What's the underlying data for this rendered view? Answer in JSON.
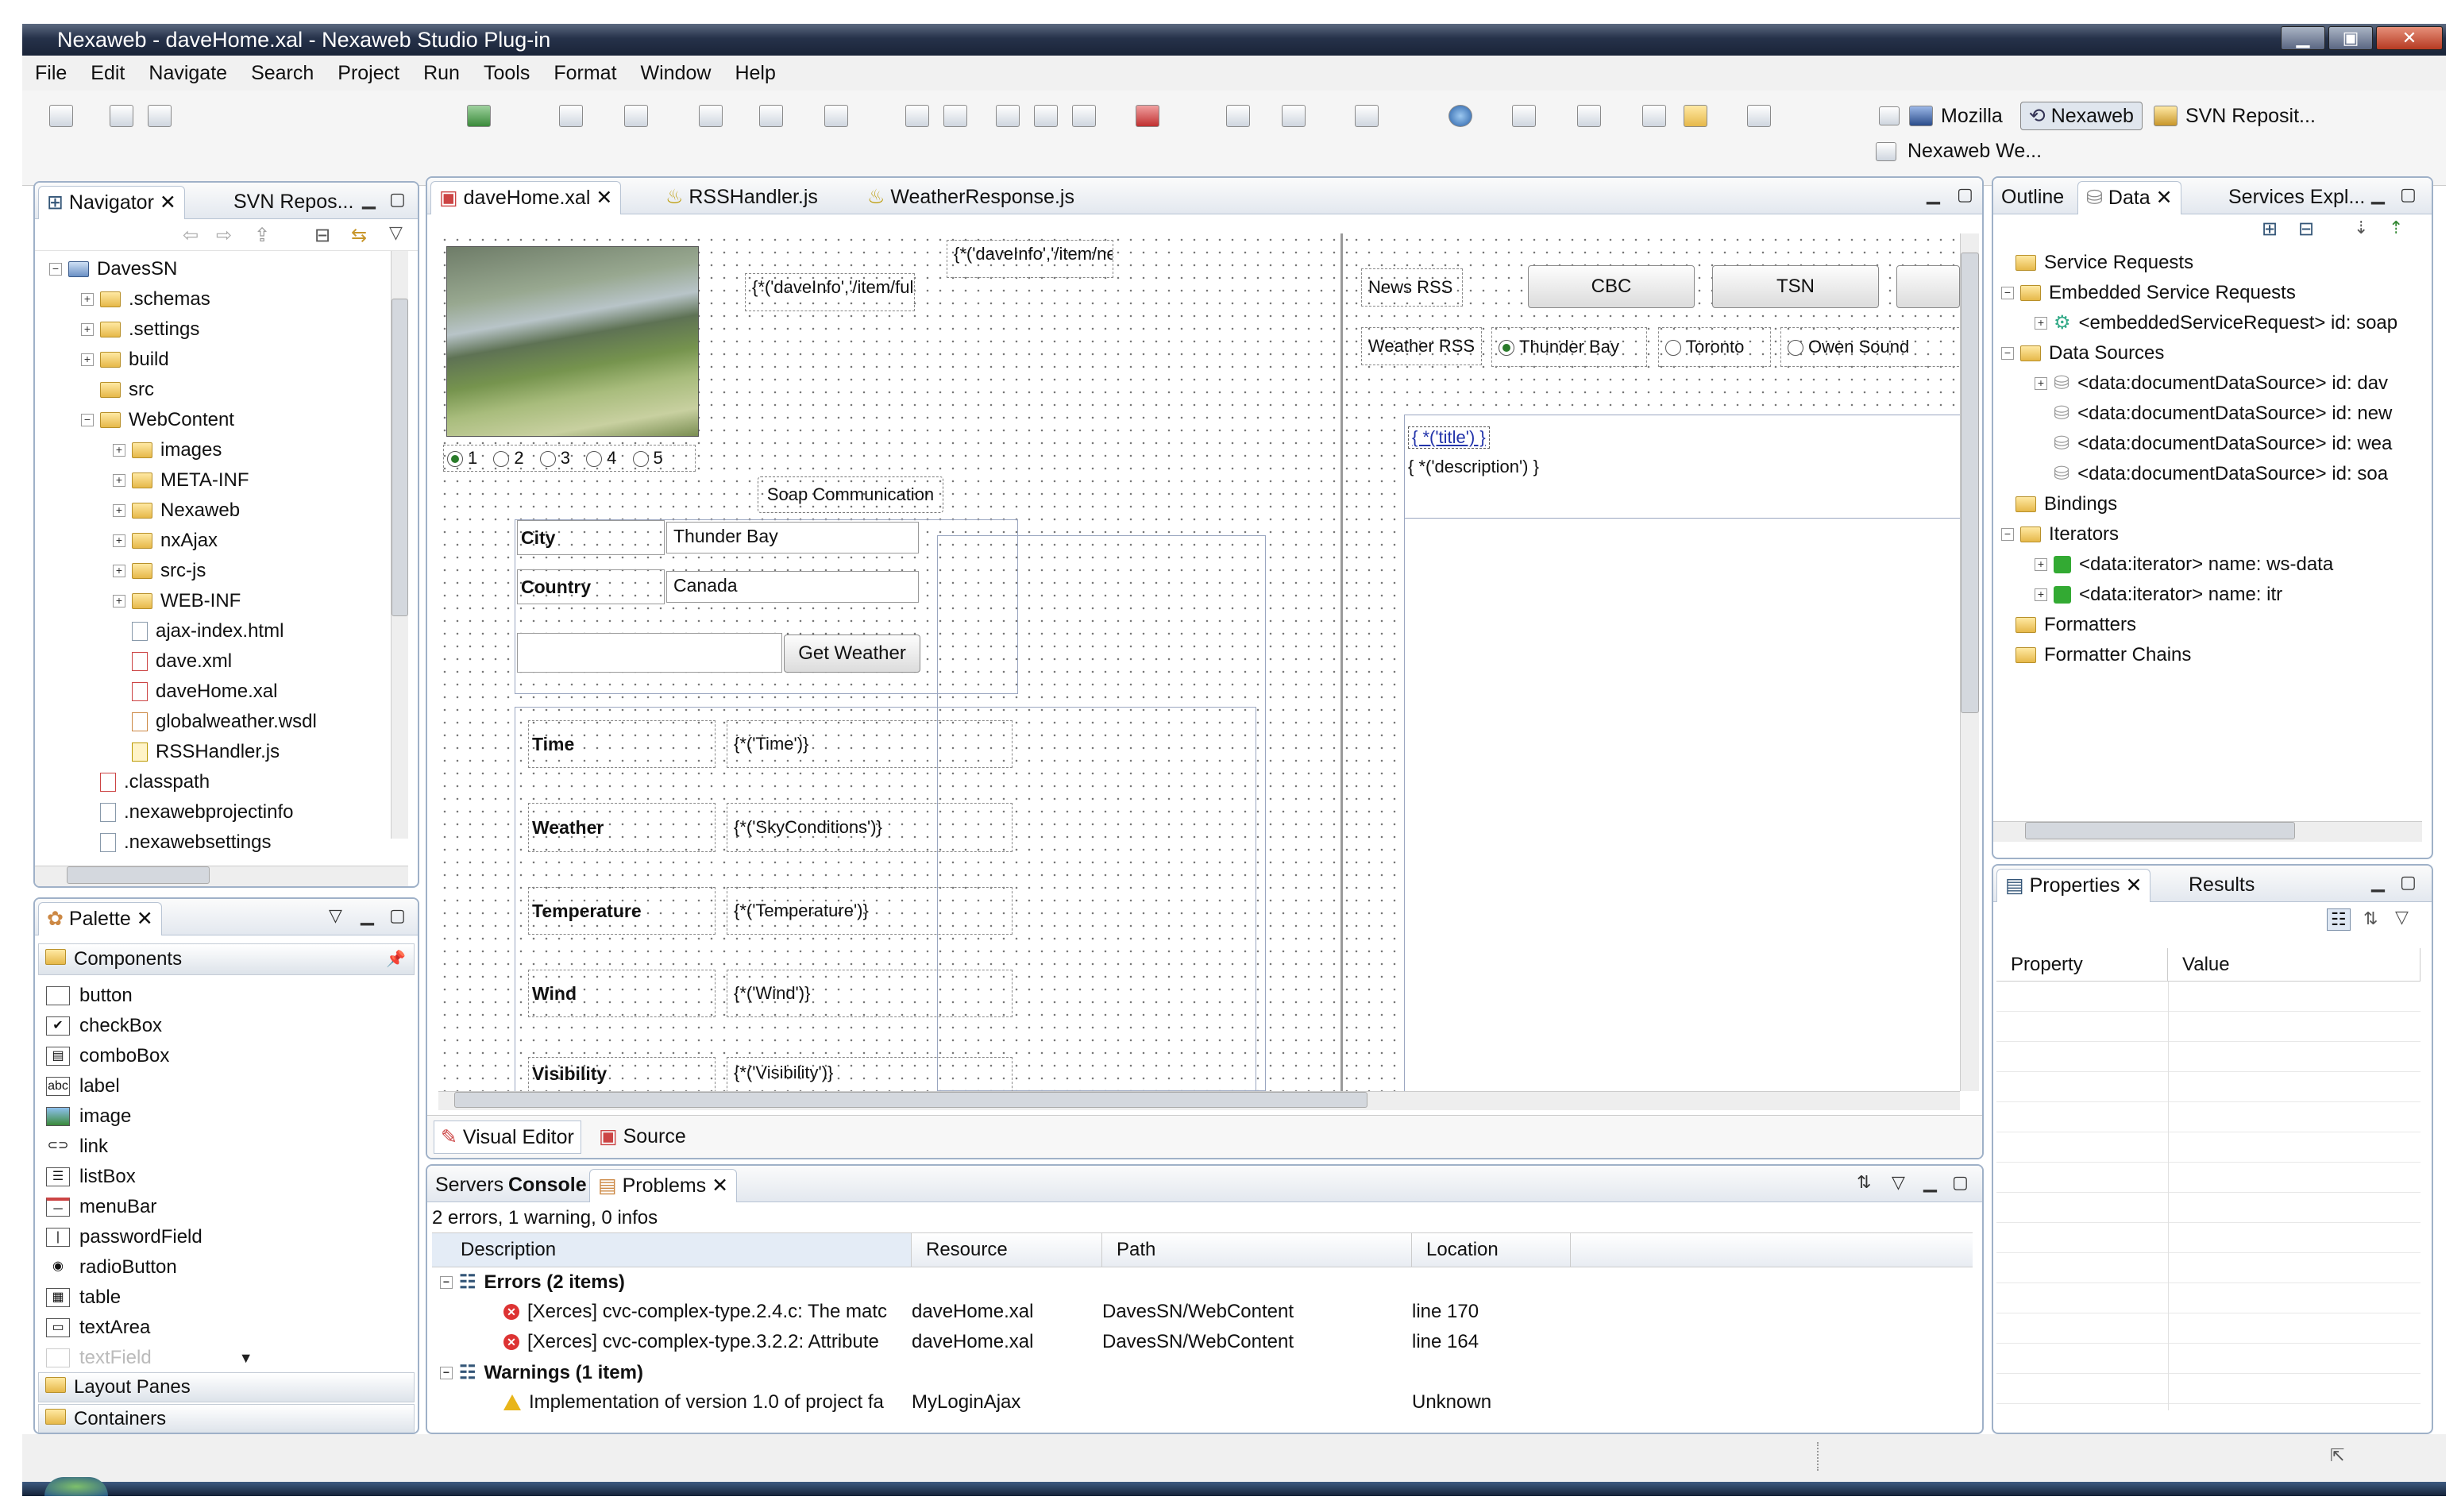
{
  "window": {
    "title": "Nexaweb - daveHome.xal - Nexaweb Studio Plug-in"
  },
  "menu": [
    "File",
    "Edit",
    "Navigate",
    "Search",
    "Project",
    "Run",
    "Tools",
    "Format",
    "Window",
    "Help"
  ],
  "perspectives": {
    "mozilla": "Mozilla",
    "nexaweb": "Nexaweb",
    "svn": "SVN Reposit...",
    "nexaweb_web": "Nexaweb We..."
  },
  "navigator": {
    "tabs": [
      "Navigator",
      "SVN Repos..."
    ],
    "project": "DavesSN",
    "items": [
      ".schemas",
      ".settings",
      "build",
      "src",
      "WebContent",
      "images",
      "META-INF",
      "Nexaweb",
      "nxAjax",
      "src-js",
      "WEB-INF",
      "ajax-index.html",
      "dave.xml",
      "daveHome.xal",
      "globalweather.wsdl",
      "RSSHandler.js",
      ".classpath",
      ".nexawebprojectinfo",
      ".nexawebsettings"
    ]
  },
  "palette": {
    "tab": "Palette",
    "components_header": "Components",
    "items": [
      "button",
      "checkBox",
      "comboBox",
      "label",
      "image",
      "link",
      "listBox",
      "menuBar",
      "passwordField",
      "radioButton",
      "table",
      "textArea",
      "textField"
    ],
    "layout_panes": "Layout Panes",
    "containers": "Containers"
  },
  "editor": {
    "tabs": [
      "daveHome.xal",
      "RSSHandler.js",
      "WeatherResponse.js"
    ],
    "bottom_tabs": [
      "Visual Editor",
      "Source"
    ],
    "binding1": "{*('daveInfo','/item/ne",
    "binding2": "{*('daveInfo','/item/ful",
    "radios": [
      "1",
      "2",
      "3",
      "4",
      "5"
    ],
    "soap_button": "Soap Communication",
    "city_label": "City",
    "city_value": "Thunder Bay",
    "country_label": "Country",
    "country_value": "Canada",
    "get_weather": "Get Weather",
    "fields": [
      {
        "label": "Time",
        "value": "{*('Time')}"
      },
      {
        "label": "Weather",
        "value": "{*('SkyConditions')}"
      },
      {
        "label": "Temperature",
        "value": "{*('Temperature')}"
      },
      {
        "label": "Wind",
        "value": "{*('Wind')}"
      },
      {
        "label": "Visibility",
        "value": "{*('Visibility')}"
      }
    ],
    "news_label": "News RSS",
    "news_buttons": [
      "CBC",
      "TSN"
    ],
    "weather_label": "Weather RSS",
    "weather_options": [
      "Thunder Bay",
      "Toronto",
      "Owen Sound"
    ],
    "rss_title": "{ *('title') }",
    "rss_desc": "{ *('description') }"
  },
  "data_panel": {
    "tabs": [
      "Outline",
      "Data",
      "Services Expl..."
    ],
    "nodes": [
      "Service Requests",
      "Embedded Service Requests",
      "<embeddedServiceRequest> id: soap",
      "Data Sources",
      "<data:documentDataSource> id: dav",
      "<data:documentDataSource> id: new",
      "<data:documentDataSource> id: wea",
      "<data:documentDataSource> id: soa",
      "Bindings",
      "Iterators",
      "<data:iterator> name: ws-data",
      "<data:iterator> name: itr",
      "Formatters",
      "Formatter Chains"
    ]
  },
  "properties": {
    "tabs": [
      "Properties",
      "Results"
    ],
    "columns": [
      "Property",
      "Value"
    ]
  },
  "problems": {
    "tabs": [
      "Servers",
      "Console",
      "Problems"
    ],
    "summary": "2 errors, 1 warning, 0 infos",
    "columns": [
      "Description",
      "Resource",
      "Path",
      "Location"
    ],
    "errors_group": "Errors (2 items)",
    "errors": [
      {
        "desc": "[Xerces] cvc-complex-type.2.4.c: The matc",
        "res": "daveHome.xal",
        "path": "DavesSN/WebContent",
        "loc": "line 170"
      },
      {
        "desc": "[Xerces] cvc-complex-type.3.2.2: Attribute",
        "res": "daveHome.xal",
        "path": "DavesSN/WebContent",
        "loc": "line 164"
      }
    ],
    "warnings_group": "Warnings (1 item)",
    "warnings": [
      {
        "desc": "Implementation of version 1.0 of project fa",
        "res": "MyLoginAjax",
        "path": "",
        "loc": "Unknown"
      }
    ]
  },
  "colors": {
    "title_bg": "#26324a",
    "accent": "#9fb1c8",
    "error": "#dd3333",
    "warning": "#e8b51a"
  }
}
